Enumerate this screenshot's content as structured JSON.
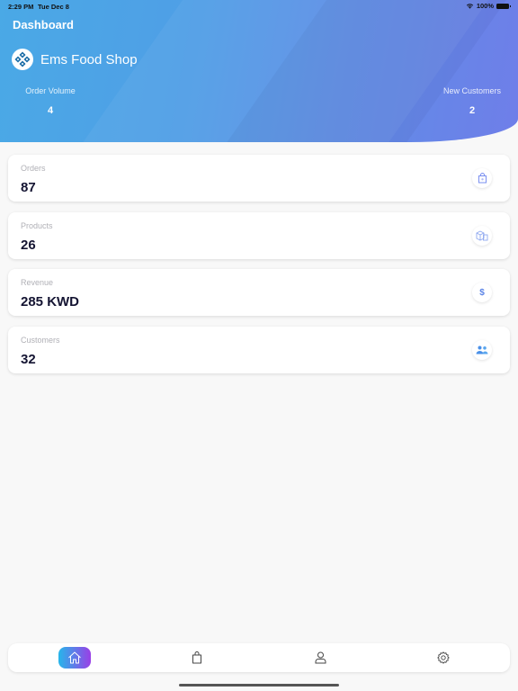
{
  "status_bar": {
    "time": "2:29 PM",
    "date": "Tue Dec 8",
    "battery": "100%"
  },
  "header": {
    "title": "Dashboard",
    "shop_name": "Ems Food Shop",
    "stats": [
      {
        "label": "Order Volume",
        "value": "4"
      },
      {
        "label": "New Customers",
        "value": "2"
      }
    ]
  },
  "cards": [
    {
      "label": "Orders",
      "value": "87",
      "icon": "shopping-bag-icon"
    },
    {
      "label": "Products",
      "value": "26",
      "icon": "boxes-icon"
    },
    {
      "label": "Revenue",
      "value": "285 KWD",
      "icon": "dollar-icon",
      "glyph": "$"
    },
    {
      "label": "Customers",
      "value": "32",
      "icon": "users-icon"
    }
  ],
  "tabbar": {
    "tabs": [
      {
        "name": "home",
        "icon": "home-icon",
        "active": true
      },
      {
        "name": "orders",
        "icon": "shopping-bag-icon",
        "active": false
      },
      {
        "name": "profile",
        "icon": "user-icon",
        "active": false
      },
      {
        "name": "settings",
        "icon": "gear-icon",
        "active": false
      }
    ]
  },
  "colors": {
    "gradient_start": "#4aa9e6",
    "gradient_end": "#6f7ee9",
    "accent": "#5b84e6",
    "value_text": "#141432",
    "active_tab_start": "#27b6ea",
    "active_tab_end": "#9a3fe6"
  }
}
